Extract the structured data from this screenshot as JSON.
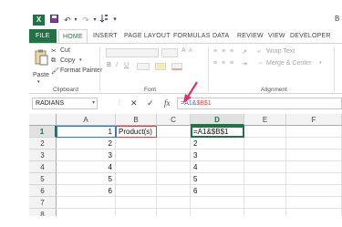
{
  "title_bar": {
    "logo": "X",
    "right_text": "B"
  },
  "tabs": [
    "FILE",
    "HOME",
    "INSERT",
    "PAGE LAYOUT",
    "FORMULAS",
    "DATA",
    "REVIEW",
    "VIEW",
    "DEVELOPER"
  ],
  "ribbon": {
    "clipboard": {
      "paste": "Paste",
      "cut": "Cut",
      "copy": "Copy",
      "format_painter": "Format Painter",
      "label": "Clipboard"
    },
    "font": {
      "label": "Font",
      "bold": "B",
      "italic": "I",
      "underline": "U"
    },
    "alignment": {
      "wrap_text": "Wrap Text",
      "merge_center": "Merge & Center",
      "label": "Alignment"
    }
  },
  "formula_bar": {
    "name_box": "RADIANS",
    "cancel": "✕",
    "enter": "✓",
    "fx": "fx",
    "formula_part1": "=A1&",
    "formula_part2": "$B$1"
  },
  "grid": {
    "columns": [
      "A",
      "B",
      "C",
      "D",
      "E",
      "F"
    ],
    "rows": [
      "1",
      "2",
      "3",
      "4",
      "5",
      "6",
      "7",
      "8"
    ],
    "col_a": [
      "1",
      "2",
      "3",
      "4",
      "5",
      "6"
    ],
    "b1": "Product(s)",
    "col_d": [
      "=A1&$B$1",
      "2",
      "3",
      "4",
      "5",
      "6"
    ]
  },
  "colors": {
    "excel_green": "#217346",
    "ref_blue": "#4472c4",
    "ref_red": "#c0504d",
    "arrow": "#d8336b"
  }
}
